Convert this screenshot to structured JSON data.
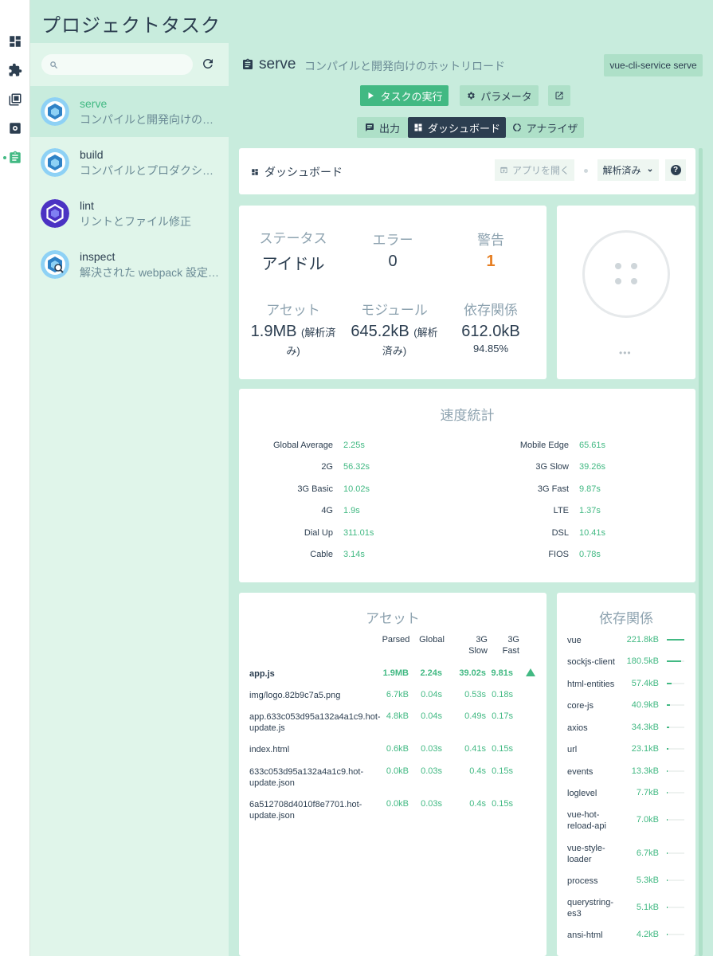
{
  "app": {
    "title": "プロジェクトタスク"
  },
  "rail": {
    "items": [
      "dashboard-icon",
      "plugins-icon",
      "dependencies-icon",
      "config-icon",
      "tasks-icon"
    ],
    "active": "tasks-icon"
  },
  "search": {
    "placeholder": ""
  },
  "tasks": [
    {
      "name": "serve",
      "description": "コンパイルと開発向けのホットリロード",
      "active": true
    },
    {
      "name": "build",
      "description": "コンパイルとプロダクション向けの最小化"
    },
    {
      "name": "lint",
      "description": "リントとファイル修正"
    },
    {
      "name": "inspect",
      "description": "解決された webpack 設定を確認"
    }
  ],
  "main": {
    "task_name": "serve",
    "task_description": "コンパイルと開発向けのホットリロード",
    "command": "vue-cli-service serve",
    "run_label": "タスクの実行",
    "params_label": "パラメータ",
    "tabs": [
      "出力",
      "ダッシュボード",
      "アナライザ"
    ],
    "active_tab": "ダッシュボード"
  },
  "dashboard": {
    "title": "ダッシュボード",
    "open_app_label": "アプリを開く",
    "mode_select": "解析済み",
    "help": "?"
  },
  "status": {
    "status_label": "ステータス",
    "status_value": "アイドル",
    "errors_label": "エラー",
    "errors_value": "0",
    "warnings_label": "警告",
    "warnings_value": "1",
    "assets_label": "アセット",
    "assets_value": "1.9MB",
    "assets_note": "(解析済",
    "assets_note2": "み)",
    "modules_label": "モジュール",
    "modules_value": "645.2kB",
    "modules_note": "(解析",
    "modules_note2": "済み)",
    "deps_label": "依存関係",
    "deps_value": "612.0kB",
    "deps_percent": "94.85%"
  },
  "server": {
    "more": "•••"
  },
  "speed": {
    "title": "速度統計",
    "left": [
      {
        "label": "Global Average",
        "value": "2.25s"
      },
      {
        "label": "2G",
        "value": "56.32s"
      },
      {
        "label": "3G Basic",
        "value": "10.02s"
      },
      {
        "label": "4G",
        "value": "1.9s"
      },
      {
        "label": "Dial Up",
        "value": "311.01s"
      },
      {
        "label": "Cable",
        "value": "3.14s"
      }
    ],
    "right": [
      {
        "label": "Mobile Edge",
        "value": "65.61s"
      },
      {
        "label": "3G Slow",
        "value": "39.26s"
      },
      {
        "label": "3G Fast",
        "value": "9.87s"
      },
      {
        "label": "LTE",
        "value": "1.37s"
      },
      {
        "label": "DSL",
        "value": "10.41s"
      },
      {
        "label": "FIOS",
        "value": "0.78s"
      }
    ]
  },
  "assets": {
    "title": "アセット",
    "headers": [
      "Parsed",
      "Global",
      "3G\nSlow",
      "3G\nFast"
    ],
    "rows": [
      {
        "name": "app.js",
        "parsed": "1.9MB",
        "global": "2.24s",
        "slow": "39.02s",
        "fast": "9.81s",
        "warning": true
      },
      {
        "name": "img/logo.82b9c7a5.png",
        "parsed": "6.7kB",
        "global": "0.04s",
        "slow": "0.53s",
        "fast": "0.18s"
      },
      {
        "name": "app.633c053d95a132a4a1c9.hot-update.js",
        "parsed": "4.8kB",
        "global": "0.04s",
        "slow": "0.49s",
        "fast": "0.17s"
      },
      {
        "name": "index.html",
        "parsed": "0.6kB",
        "global": "0.03s",
        "slow": "0.41s",
        "fast": "0.15s"
      },
      {
        "name": "633c053d95a132a4a1c9.hot-update.json",
        "parsed": "0.0kB",
        "global": "0.03s",
        "slow": "0.4s",
        "fast": "0.15s"
      },
      {
        "name": "6a512708d4010f8e7701.hot-update.json",
        "parsed": "0.0kB",
        "global": "0.03s",
        "slow": "0.4s",
        "fast": "0.15s"
      }
    ]
  },
  "dependencies": {
    "title": "依存関係",
    "rows": [
      {
        "name": "vue",
        "size": "221.8kB",
        "ratio": 1.0
      },
      {
        "name": "sockjs-client",
        "size": "180.5kB",
        "ratio": 0.81
      },
      {
        "name": "html-entities",
        "size": "57.4kB",
        "ratio": 0.26
      },
      {
        "name": "core-js",
        "size": "40.9kB",
        "ratio": 0.18
      },
      {
        "name": "axios",
        "size": "34.3kB",
        "ratio": 0.15
      },
      {
        "name": "url",
        "size": "23.1kB",
        "ratio": 0.1
      },
      {
        "name": "events",
        "size": "13.3kB",
        "ratio": 0.06
      },
      {
        "name": "loglevel",
        "size": "7.7kB",
        "ratio": 0.035
      },
      {
        "name": "vue-hot-reload-api",
        "size": "7.0kB",
        "ratio": 0.03
      },
      {
        "name": "vue-style-loader",
        "size": "6.7kB",
        "ratio": 0.03
      },
      {
        "name": "process",
        "size": "5.3kB",
        "ratio": 0.024
      },
      {
        "name": "querystring-es3",
        "size": "5.1kB",
        "ratio": 0.023
      },
      {
        "name": "ansi-html",
        "size": "4.2kB",
        "ratio": 0.019
      }
    ]
  },
  "colors": {
    "accent": "#42b983",
    "warning": "#e67e22",
    "dark": "#2c3e50",
    "bg": "#c8ecdd"
  }
}
